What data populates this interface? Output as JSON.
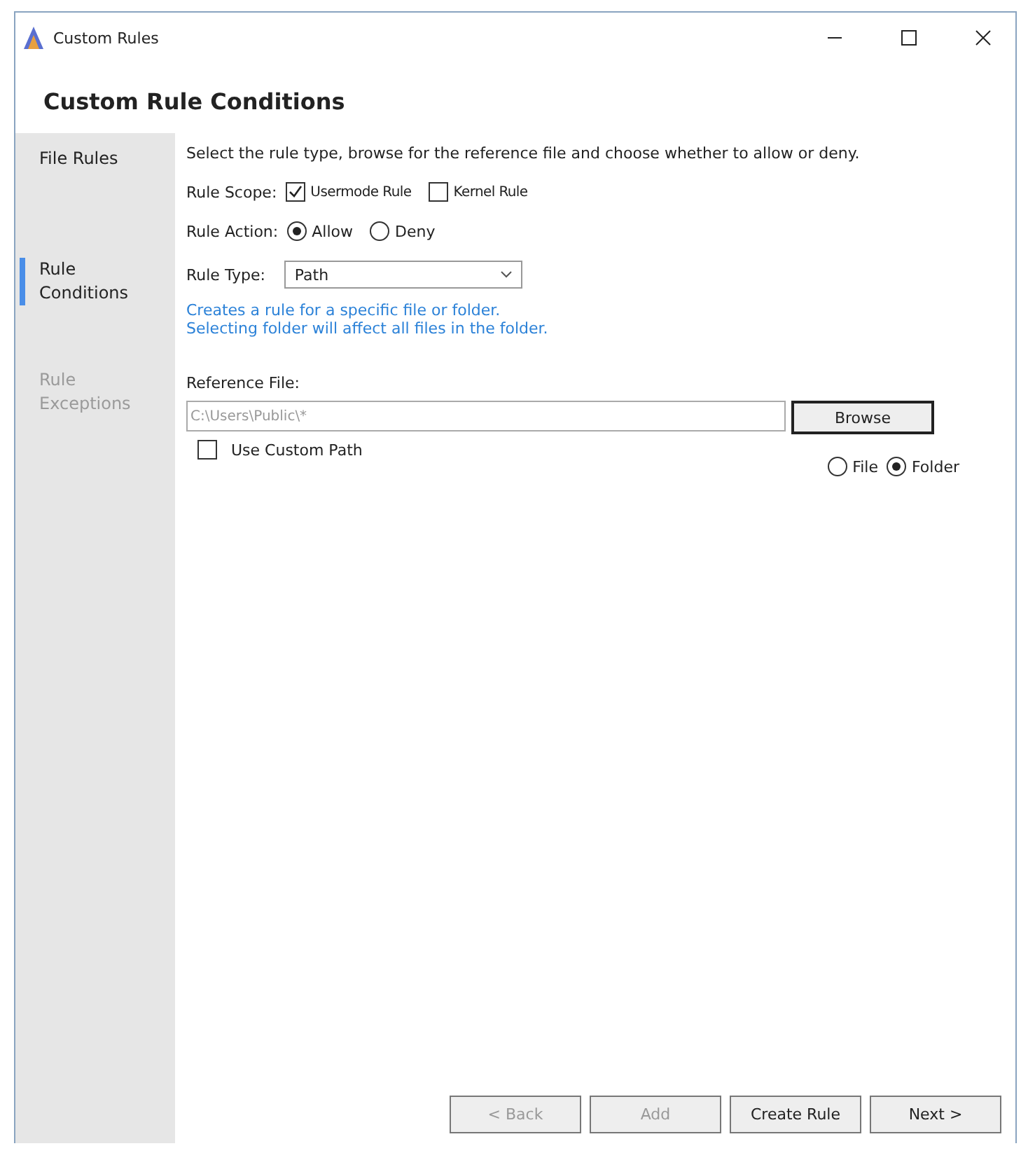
{
  "window": {
    "title": "Custom Rules"
  },
  "header": "Custom Rule Conditions",
  "sidebar": {
    "items": [
      {
        "label": "File Rules",
        "selected": false,
        "disabled": false
      },
      {
        "label": "Rule Conditions",
        "selected": true,
        "disabled": false
      },
      {
        "label": "Rule Exceptions",
        "selected": false,
        "disabled": true
      }
    ]
  },
  "description": "Select the rule type, browse for the reference file and choose whether to allow or deny.",
  "rule_scope": {
    "label": "Rule Scope:",
    "options": [
      {
        "label": "Usermode Rule",
        "checked": true
      },
      {
        "label": "Kernel Rule",
        "checked": false
      }
    ]
  },
  "rule_action": {
    "label": "Rule Action:",
    "options": [
      {
        "label": "Allow",
        "selected": true
      },
      {
        "label": "Deny",
        "selected": false
      }
    ]
  },
  "rule_type": {
    "label": "Rule Type:",
    "value": "Path"
  },
  "hint": [
    "Creates a rule for a specific file or folder.",
    "Selecting folder will affect all files in the folder."
  ],
  "reference": {
    "label": "Reference File:",
    "placeholder": "C:\\Users\\Public\\*",
    "browse": "Browse",
    "custom_path": {
      "label": "Use Custom Path",
      "checked": false
    },
    "target": [
      {
        "label": "File",
        "selected": false
      },
      {
        "label": "Folder",
        "selected": true
      }
    ]
  },
  "buttons": [
    {
      "label": "< Back",
      "disabled": true
    },
    {
      "label": "Add",
      "disabled": true
    },
    {
      "label": "Create Rule",
      "disabled": false
    },
    {
      "label": "Next >",
      "disabled": false
    }
  ]
}
